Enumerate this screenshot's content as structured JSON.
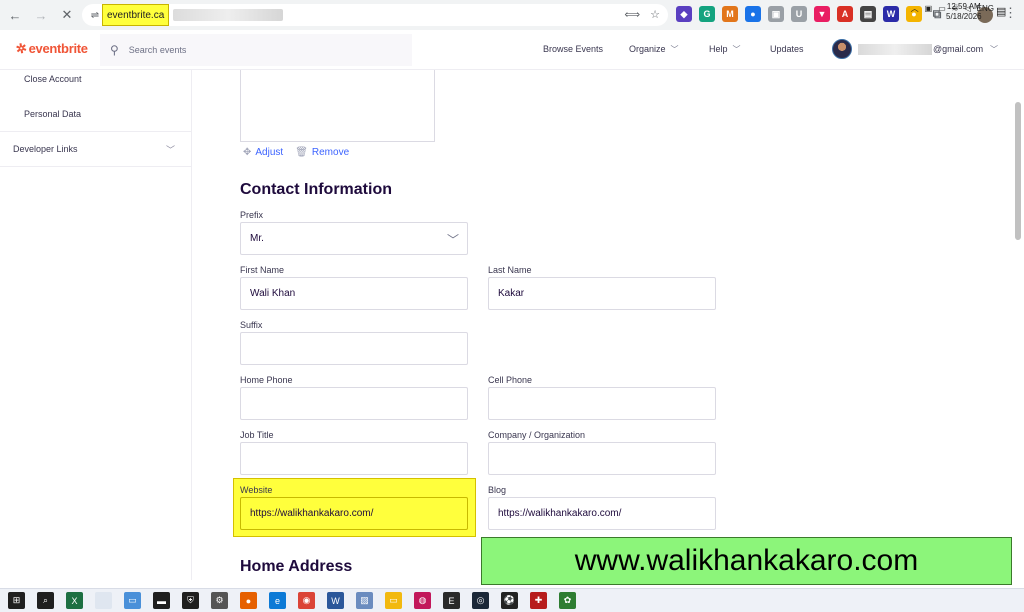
{
  "browser": {
    "url_highlighted": "eventbrite.ca",
    "extensions": [
      {
        "name": "extension-1",
        "color": "#5a3fc0",
        "glyph": "◆"
      },
      {
        "name": "extension-2",
        "color": "#14a37f",
        "glyph": "G"
      },
      {
        "name": "extension-3",
        "color": "#e2761b",
        "glyph": "M"
      },
      {
        "name": "extension-4",
        "color": "#1a73e8",
        "glyph": "●"
      },
      {
        "name": "extension-5",
        "color": "#9aa0a6",
        "glyph": "▣"
      },
      {
        "name": "extension-6",
        "color": "#9aa0a6",
        "glyph": "U"
      },
      {
        "name": "extension-7",
        "color": "#e91e63",
        "glyph": "▼"
      },
      {
        "name": "extension-8",
        "color": "#d93025",
        "glyph": "A"
      },
      {
        "name": "extension-9",
        "color": "#444444",
        "glyph": "▤"
      },
      {
        "name": "extension-10",
        "color": "#2b2ba8",
        "glyph": "W"
      },
      {
        "name": "extension-11",
        "color": "#f4b400",
        "glyph": "●"
      }
    ]
  },
  "header": {
    "logo": "eventbrite",
    "search_placeholder": "Search events",
    "nav": {
      "browse": "Browse Events",
      "organize": "Organize",
      "help": "Help",
      "updates": "Updates"
    },
    "email_suffix": "@gmail.com"
  },
  "sidebar": {
    "close_account": "Close Account",
    "personal_data": "Personal Data",
    "developer_links": "Developer Links"
  },
  "image_actions": {
    "adjust": "Adjust",
    "remove": "Remove"
  },
  "contact": {
    "title": "Contact Information",
    "prefix_label": "Prefix",
    "prefix_value": "Mr.",
    "first_name_label": "First Name",
    "first_name_value": "Wali Khan",
    "last_name_label": "Last Name",
    "last_name_value": "Kakar",
    "suffix_label": "Suffix",
    "suffix_value": "",
    "home_phone_label": "Home Phone",
    "home_phone_value": "",
    "cell_phone_label": "Cell Phone",
    "cell_phone_value": "",
    "job_title_label": "Job Title",
    "job_title_value": "",
    "company_label": "Company / Organization",
    "company_value": "",
    "website_label": "Website",
    "website_value": "https://walikhankakaro.com/",
    "blog_label": "Blog",
    "blog_value": "https://walikhankakaro.com/"
  },
  "home_address": {
    "title": "Home Address"
  },
  "watermark": "www.walikhankakaro.com",
  "taskbar": {
    "tray_lang": "ENG",
    "time": "12:59 AM",
    "date": "5/18/2026",
    "apps": [
      {
        "name": "windows-start-icon",
        "color": "#1f1f1f",
        "glyph": "⊞"
      },
      {
        "name": "search-icon",
        "color": "#1f1f1f",
        "glyph": "⌕"
      },
      {
        "name": "excel-icon",
        "color": "#1d6f42",
        "glyph": "X"
      },
      {
        "name": "notepad-icon",
        "color": "#dfe6f0",
        "glyph": ""
      },
      {
        "name": "display-icon",
        "color": "#4a90d9",
        "glyph": "▭"
      },
      {
        "name": "terminal-icon",
        "color": "#1f1f1f",
        "glyph": "▬"
      },
      {
        "name": "security-icon",
        "color": "#1f1f1f",
        "glyph": "⛨"
      },
      {
        "name": "settings-icon",
        "color": "#555555",
        "glyph": "⚙"
      },
      {
        "name": "firefox-icon",
        "color": "#e66000",
        "glyph": "●"
      },
      {
        "name": "edge-icon",
        "color": "#0c7ad6",
        "glyph": "e"
      },
      {
        "name": "chrome-icon",
        "color": "#db4437",
        "glyph": "◉"
      },
      {
        "name": "word-icon",
        "color": "#2b579a",
        "glyph": "W"
      },
      {
        "name": "photos-icon",
        "color": "#6b8cbf",
        "glyph": "▨"
      },
      {
        "name": "file-explorer-icon",
        "color": "#f2b90f",
        "glyph": "▭"
      },
      {
        "name": "colorful-app-icon",
        "color": "#c2185b",
        "glyph": "◍"
      },
      {
        "name": "epic-games-icon",
        "color": "#2a2a2a",
        "glyph": "E"
      },
      {
        "name": "steam-icon",
        "color": "#1b2838",
        "glyph": "◎"
      },
      {
        "name": "soccer-icon",
        "color": "#222222",
        "glyph": "⚽"
      },
      {
        "name": "shield-game-icon",
        "color": "#b71c1c",
        "glyph": "✚"
      },
      {
        "name": "app-icon",
        "color": "#2e7d32",
        "glyph": "✿"
      }
    ]
  }
}
